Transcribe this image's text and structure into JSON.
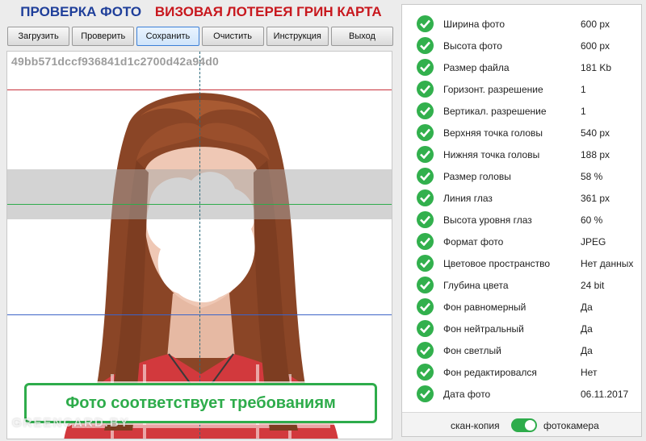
{
  "header": {
    "title_left": "ПРОВЕРКА ФОТО",
    "title_right": "ВИЗОВАЯ ЛОТЕРЕЯ ГРИН КАРТА",
    "color_left": "#1f3f9a",
    "color_right": "#c8181e"
  },
  "toolbar": {
    "buttons": [
      {
        "label": "Загрузить"
      },
      {
        "label": "Проверить"
      },
      {
        "label": "Сохранить"
      },
      {
        "label": "Очистить"
      },
      {
        "label": "Инструкция"
      },
      {
        "label": "Выход"
      }
    ],
    "active_index": 2
  },
  "photo": {
    "hash": "49bb571dccf936841d1c2700d42a94d0",
    "banner": "Фото соответствует требованиям",
    "watermark": "GREENCARD.BY",
    "guide_colors": {
      "top": "#c8323c",
      "eye": "#2eac4b",
      "bottom": "#3c64c8",
      "center": "#2b6a7c"
    }
  },
  "results": {
    "status_icon": "check-circle-icon",
    "status_color": "#32b04d",
    "rows": [
      {
        "label": "Ширина фото",
        "value": "600 px"
      },
      {
        "label": "Высота фото",
        "value": "600 px"
      },
      {
        "label": "Размер файла",
        "value": "181 Kb"
      },
      {
        "label": "Горизонт. разрешение",
        "value": "1"
      },
      {
        "label": "Вертикал. разрешение",
        "value": "1"
      },
      {
        "label": "Верхняя точка головы",
        "value": "540 px"
      },
      {
        "label": "Нижняя точка головы",
        "value": "188 px"
      },
      {
        "label": "Размер головы",
        "value": "58 %"
      },
      {
        "label": "Линия глаз",
        "value": "361 px"
      },
      {
        "label": "Высота уровня глаз",
        "value": "60 %"
      },
      {
        "label": "Формат фото",
        "value": "JPEG"
      },
      {
        "label": "Цветовое пространство",
        "value": "Нет данных"
      },
      {
        "label": "Глубина цвета",
        "value": "24 bit"
      },
      {
        "label": "Фон равномерный",
        "value": "Да"
      },
      {
        "label": "Фон нейтральный",
        "value": "Да"
      },
      {
        "label": "Фон светлый",
        "value": "Да"
      },
      {
        "label": "Фон редактировался",
        "value": "Нет"
      },
      {
        "label": "Дата фото",
        "value": "06.11.2017"
      }
    ]
  },
  "mode": {
    "left_label": "скан-копия",
    "right_label": "фотокамера",
    "toggle_on": true
  }
}
